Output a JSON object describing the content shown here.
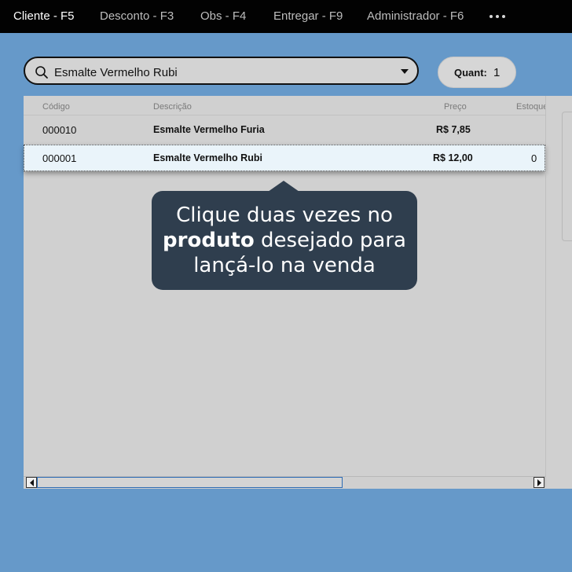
{
  "menu": {
    "items": [
      {
        "label": "Cliente - F5",
        "active": true
      },
      {
        "label": "Desconto - F3"
      },
      {
        "label": "Obs - F4"
      },
      {
        "label": "Entregar - F9"
      },
      {
        "label": "Administrador - F6"
      }
    ],
    "more_icon": "ellipsis-icon"
  },
  "search": {
    "value": "Esmalte Vermelho Rubi",
    "icon": "search-icon",
    "dropdown_icon": "caret-down-icon"
  },
  "quantity": {
    "label": "Quant:",
    "value": "1"
  },
  "grid": {
    "columns": [
      "Código",
      "Descrição",
      "Preço",
      "Estoque"
    ],
    "rows": [
      {
        "codigo": "000010",
        "descricao": "Esmalte Vermelho Furia",
        "preco": "R$ 7,85",
        "estoque": ""
      },
      {
        "codigo": "000001",
        "descricao": "Esmalte Vermelho Rubi",
        "preco": "R$ 12,00",
        "estoque": "0",
        "selected": true
      }
    ]
  },
  "tooltip": {
    "line1": "Clique duas vezes no",
    "bold": "produto",
    "line2_rest": " desejado para",
    "line3": "lançá-lo na venda"
  },
  "colors": {
    "background": "#6699c9",
    "topbar": "#020202",
    "tooltip": "#2f3e4e",
    "selected_row": "#eaf4fa"
  }
}
